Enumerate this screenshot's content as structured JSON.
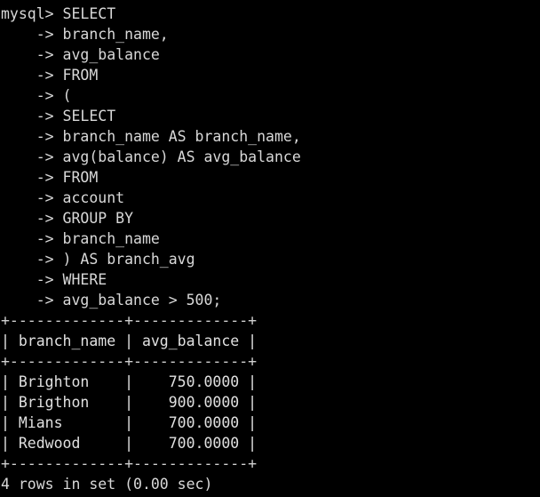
{
  "terminal": {
    "background_color": "#000000",
    "foreground_color": "#d8d8d8",
    "prompt": "mysql>",
    "continuation_prompt": "->",
    "width_chars": 61,
    "first_line": "mysql> SELECT",
    "query_lines": [
      "    -> branch_name,",
      "    -> avg_balance",
      "    -> FROM",
      "    -> (",
      "    -> SELECT",
      "    -> branch_name AS branch_name,",
      "    -> avg(balance) AS avg_balance",
      "    -> FROM",
      "    -> account",
      "    -> GROUP BY",
      "    -> branch_name",
      "    -> ) AS branch_avg",
      "    -> WHERE",
      "    -> avg_balance > 500;"
    ],
    "query_text": "SELECT branch_name, avg_balance FROM ( SELECT branch_name AS branch_name, avg(balance) AS avg_balance FROM account GROUP BY branch_name ) AS branch_avg WHERE avg_balance > 500;",
    "result_table": {
      "top_border": "+-------------+-------------+",
      "header_row": "| branch_name | avg_balance |",
      "header_separator": "+-------------+-------------+",
      "bottom_border": "+-------------+-------------+",
      "columns": [
        "branch_name",
        "avg_balance"
      ],
      "column_alignments": [
        "left",
        "right"
      ],
      "rows": [
        [
          "Brighton",
          "750.0000"
        ],
        [
          "Brigthon",
          "900.0000"
        ],
        [
          "Mians",
          "700.0000"
        ],
        [
          "Redwood",
          "700.0000"
        ]
      ],
      "row_lines": [
        "| Brighton    |    750.0000 |",
        "| Brigthon    |    900.0000 |",
        "| Mians       |    700.0000 |",
        "| Redwood     |    700.0000 |"
      ]
    },
    "status": {
      "row_count": 4,
      "text": "4 rows in set (0.00 sec)",
      "elapsed": "0.00 sec"
    }
  }
}
